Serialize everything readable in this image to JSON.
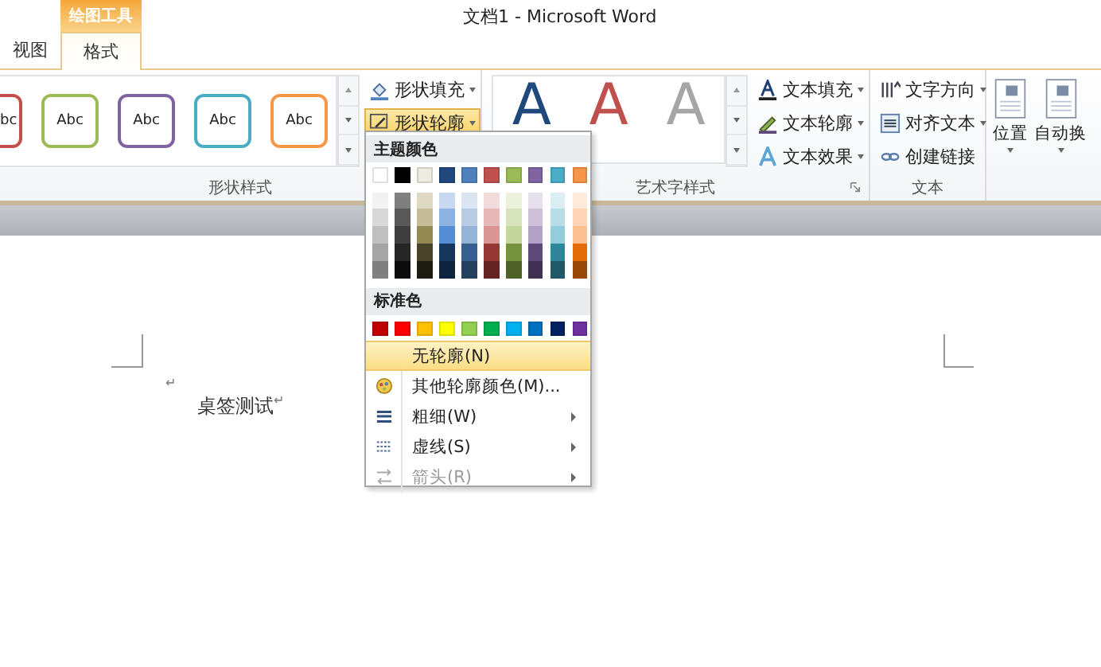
{
  "window": {
    "title": "文档1 - Microsoft Word"
  },
  "contextual_tab": "绘图工具",
  "tabs": [
    {
      "label": "视图",
      "selected": false
    },
    {
      "label": "格式",
      "selected": true
    }
  ],
  "shape_styles": {
    "gallery": [
      {
        "text": "bc",
        "color": "#c0504d"
      },
      {
        "text": "Abc",
        "color": "#9bbb59"
      },
      {
        "text": "Abc",
        "color": "#8064a2"
      },
      {
        "text": "Abc",
        "color": "#4bacc6"
      },
      {
        "text": "Abc",
        "color": "#f79646"
      }
    ],
    "commands": [
      {
        "label": "形状填充",
        "selected": false
      },
      {
        "label": "形状轮廓",
        "selected": true
      }
    ],
    "group_label": "形状样式"
  },
  "wordart": {
    "gallery": [
      {
        "text": "A",
        "color": "#1f497d"
      },
      {
        "text": "A",
        "color": "#c0504d"
      },
      {
        "text": "A",
        "color": "#a5a5a5"
      }
    ],
    "commands": [
      {
        "label": "文本填充"
      },
      {
        "label": "文本轮廓"
      },
      {
        "label": "文本效果"
      }
    ],
    "group_label": "艺术字样式"
  },
  "text_group": {
    "commands": [
      {
        "label": "文字方向",
        "dropdown": true
      },
      {
        "label": "对齐文本",
        "dropdown": true
      },
      {
        "label": "创建链接",
        "dropdown": false
      }
    ],
    "group_label": "文本"
  },
  "arrange": {
    "commands": [
      {
        "label": "位置"
      },
      {
        "label": "自动换"
      }
    ]
  },
  "outline_menu": {
    "theme_heading": "主题颜色",
    "theme_colors": [
      {
        "color": "#ffffff",
        "shades": [
          {
            "color": "#f2f2f2"
          },
          {
            "color": "#d8d8d8"
          },
          {
            "color": "#bfbfbf"
          },
          {
            "color": "#a5a5a5"
          },
          {
            "color": "#7f7f7f"
          }
        ]
      },
      {
        "color": "#000000",
        "shades": [
          {
            "color": "#7f7f7f"
          },
          {
            "color": "#595959"
          },
          {
            "color": "#3f3f3f"
          },
          {
            "color": "#262626"
          },
          {
            "color": "#0c0c0c"
          }
        ]
      },
      {
        "color": "#eeece1",
        "shades": [
          {
            "color": "#ddd9c3"
          },
          {
            "color": "#c4bd97"
          },
          {
            "color": "#938953"
          },
          {
            "color": "#494429"
          },
          {
            "color": "#1d1b10"
          }
        ]
      },
      {
        "color": "#1f497d",
        "shades": [
          {
            "color": "#c6d9f0"
          },
          {
            "color": "#8db3e2"
          },
          {
            "color": "#548dd4"
          },
          {
            "color": "#17365d"
          },
          {
            "color": "#0f243e"
          }
        ]
      },
      {
        "color": "#4f81bd",
        "shades": [
          {
            "color": "#dbe5f1"
          },
          {
            "color": "#b8cce4"
          },
          {
            "color": "#95b3d7"
          },
          {
            "color": "#366092"
          },
          {
            "color": "#244061"
          }
        ]
      },
      {
        "color": "#c0504d",
        "shades": [
          {
            "color": "#f2dcdb"
          },
          {
            "color": "#e5b9b7"
          },
          {
            "color": "#d99694"
          },
          {
            "color": "#953734"
          },
          {
            "color": "#632423"
          }
        ]
      },
      {
        "color": "#9bbb59",
        "shades": [
          {
            "color": "#ebf1dd"
          },
          {
            "color": "#d7e3bc"
          },
          {
            "color": "#c3d69b"
          },
          {
            "color": "#76923c"
          },
          {
            "color": "#4f6128"
          }
        ]
      },
      {
        "color": "#8064a2",
        "shades": [
          {
            "color": "#e5e0ec"
          },
          {
            "color": "#ccc1d9"
          },
          {
            "color": "#b2a2c7"
          },
          {
            "color": "#5f497a"
          },
          {
            "color": "#3f3151"
          }
        ]
      },
      {
        "color": "#4bacc6",
        "shades": [
          {
            "color": "#dbeef3"
          },
          {
            "color": "#b7dde8"
          },
          {
            "color": "#92cddc"
          },
          {
            "color": "#31859b"
          },
          {
            "color": "#205867"
          }
        ]
      },
      {
        "color": "#f79646",
        "shades": [
          {
            "color": "#fdeada"
          },
          {
            "color": "#fbd5b5"
          },
          {
            "color": "#fac08f"
          },
          {
            "color": "#e36c09"
          },
          {
            "color": "#974806"
          }
        ]
      }
    ],
    "standard_heading": "标准色",
    "standard_colors": [
      {
        "color": "#c00000"
      },
      {
        "color": "#ff0000"
      },
      {
        "color": "#ffc000"
      },
      {
        "color": "#ffff00"
      },
      {
        "color": "#92d050"
      },
      {
        "color": "#00b050"
      },
      {
        "color": "#00b0f0"
      },
      {
        "color": "#0070c0"
      },
      {
        "color": "#002060"
      },
      {
        "color": "#7030a0"
      }
    ],
    "items": [
      {
        "label": "无轮廓(N)",
        "kind": "plain",
        "selected": true,
        "disabled": false,
        "submenu": false
      },
      {
        "label": "其他轮廓颜色(M)...",
        "kind": "palette",
        "selected": false,
        "disabled": false,
        "submenu": false
      },
      {
        "label": "粗细(W)",
        "kind": "weight",
        "selected": false,
        "disabled": false,
        "submenu": true
      },
      {
        "label": "虚线(S)",
        "kind": "dash",
        "selected": false,
        "disabled": false,
        "submenu": true
      },
      {
        "label": "箭头(R)",
        "kind": "arrow",
        "selected": false,
        "disabled": true,
        "submenu": true
      }
    ]
  },
  "document": {
    "marks": [
      "↵"
    ],
    "text": "桌签测试",
    "end_mark": "↵"
  }
}
